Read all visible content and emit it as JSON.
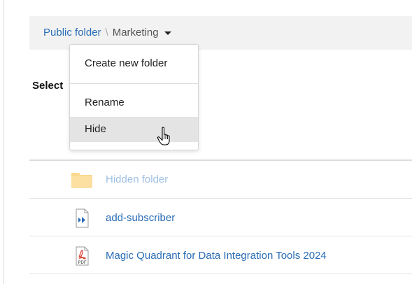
{
  "breadcrumb": {
    "root_label": "Public folder",
    "separator": "\\",
    "current_label": "Marketing"
  },
  "select_label": "Select",
  "menu": {
    "items": [
      {
        "label": "Create new folder"
      },
      {
        "label": "Rename"
      },
      {
        "label": "Hide"
      }
    ],
    "highlighted": "Hide"
  },
  "files": [
    {
      "name": "Hidden folder",
      "icon": "folder-icon",
      "state": "hidden"
    },
    {
      "name": "add-subscriber",
      "icon": "document-icon"
    },
    {
      "name": "Magic Quadrant for Data Integration Tools 2024",
      "icon": "pdf-icon",
      "icon_text": "PDF"
    }
  ],
  "colors": {
    "link": "#2a6db6",
    "hidden_link": "#9ebfe3",
    "folder": "#fbd98f",
    "breadcrumb_bg": "#f2f2f2",
    "menu_highlight": "#e4e4e4",
    "pdf_red": "#d9362b"
  }
}
